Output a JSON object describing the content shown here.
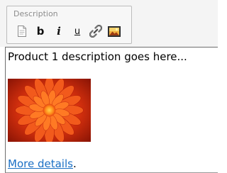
{
  "toolbar": {
    "legend": "Description",
    "buttons": [
      {
        "name": "source-button",
        "icon": "document-icon",
        "label": ""
      },
      {
        "name": "bold-button",
        "icon": "bold-icon",
        "label": "b"
      },
      {
        "name": "italic-button",
        "icon": "italic-icon",
        "label": "i"
      },
      {
        "name": "underline-button",
        "icon": "underline-icon",
        "label": "u"
      },
      {
        "name": "link-button",
        "icon": "chain-link-icon",
        "label": ""
      },
      {
        "name": "image-button",
        "icon": "image-icon",
        "label": ""
      }
    ]
  },
  "editor": {
    "text": "Product 1 description goes here...",
    "image_alt": "red chrysanthemum flower",
    "link_text": "More details",
    "trailing_text": "."
  },
  "colors": {
    "link": "#1a6fc4",
    "toolbar_bg": "#f4f4f4",
    "flower_red": "#d8280e",
    "flower_orange": "#f36a1d"
  }
}
